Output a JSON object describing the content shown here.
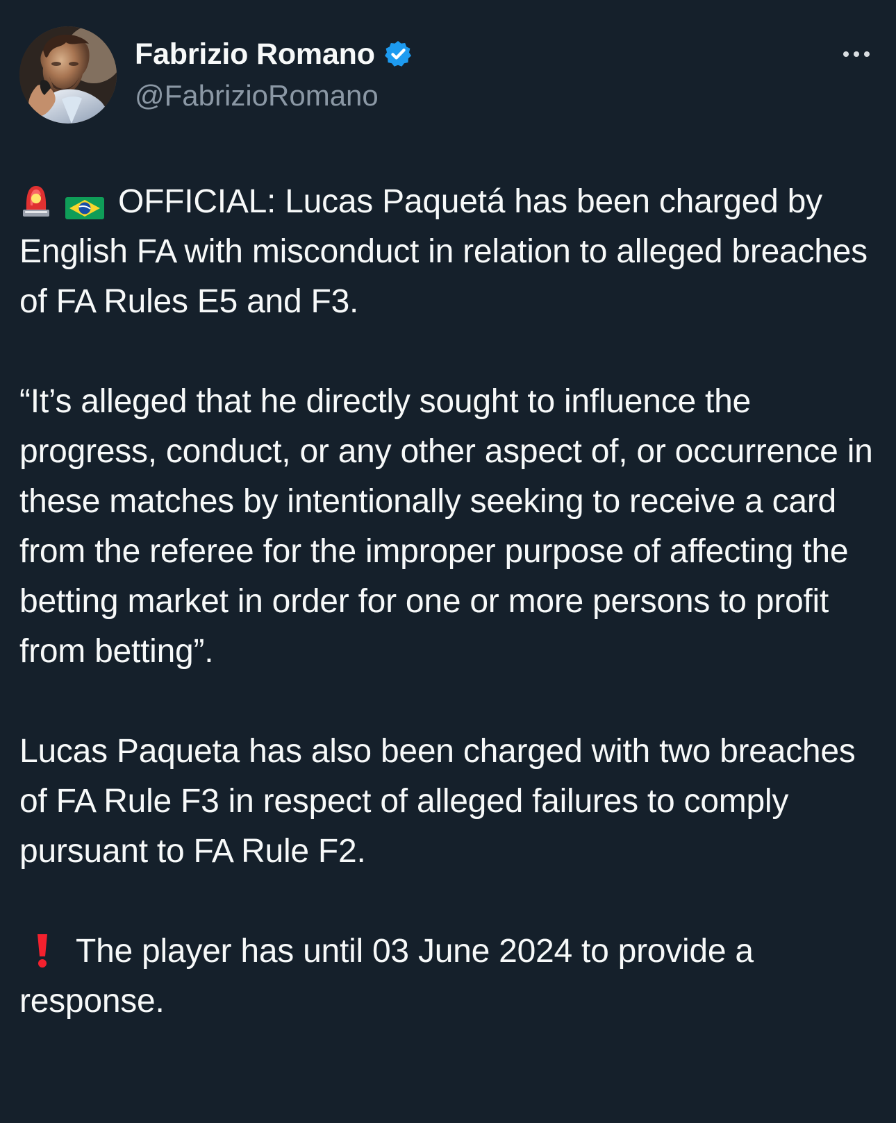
{
  "tweet": {
    "author": {
      "name": "Fabrizio Romano",
      "handle": "@FabrizioRomano",
      "verified": true,
      "avatar_icon": "profile-photo"
    },
    "menu_icon": "more-options-icon",
    "paragraphs": [
      {
        "icons": [
          "police-light-icon",
          "brazil-flag-icon"
        ],
        "text": "OFFICIAL: Lucas Paquetá has been charged by English FA with misconduct in relation to alleged breaches of FA Rules E5 and F3."
      },
      {
        "icons": [],
        "text": "“It’s alleged that he directly sought to influence the progress, conduct, or any other aspect of, or occurrence in these matches by intentionally seeking to receive a card from the referee for the improper purpose of affecting the betting market in order for one or more persons to profit from betting”."
      },
      {
        "icons": [],
        "text": "Lucas Paqueta has also been charged with two breaches of FA Rule F3 in respect of alleged failures to comply pursuant to FA Rule F2."
      },
      {
        "icons": [
          "exclamation-icon"
        ],
        "text": "The player has until 03 June 2024 to provide a response."
      }
    ],
    "colors": {
      "background": "#15202b",
      "text": "#f7f9f9",
      "muted": "#8b98a5",
      "verified": "#1d9bf0",
      "alert": "#f4212e"
    }
  }
}
